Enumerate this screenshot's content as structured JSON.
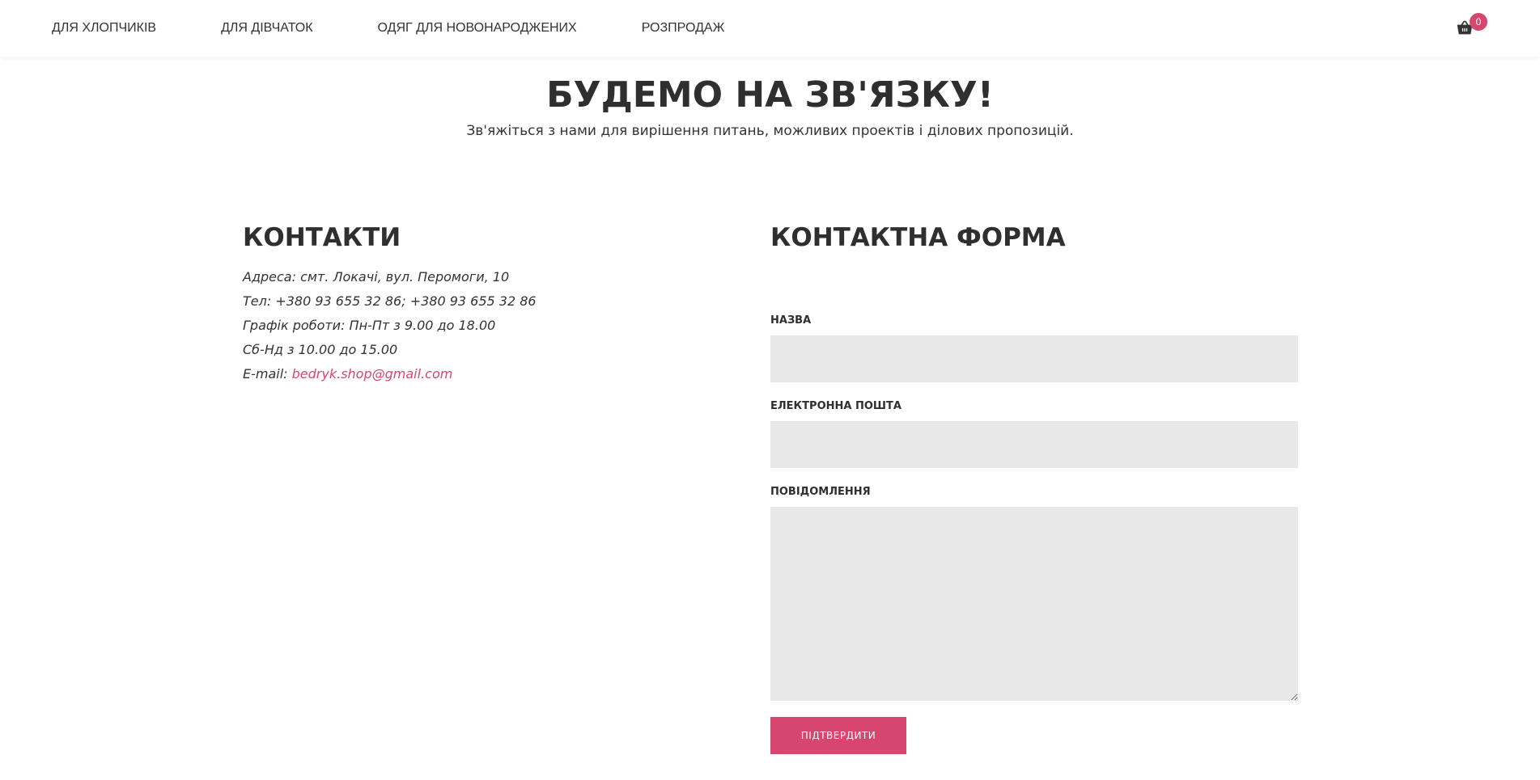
{
  "nav": {
    "items": [
      {
        "label": "ДЛЯ ХЛОПЧИКІВ"
      },
      {
        "label": "ДЛЯ ДІВЧАТОК"
      },
      {
        "label": "ОДЯГ ДЛЯ НОВОНАРОДЖЕНИХ"
      },
      {
        "label": "РОЗПРОДАЖ"
      }
    ],
    "cart": {
      "icon": "basket-icon",
      "count": "0"
    }
  },
  "hero": {
    "title": "БУДЕМО НА ЗВ'ЯЗКУ!",
    "subtitle": "Зв'яжіться з нами для вирішення питань, можливих проектів і ділових пропозицій."
  },
  "contacts": {
    "heading": "КОНТАКТИ",
    "address": "Адреса: смт. Локачі, вул. Перомоги, 10",
    "phone": "Тел: +380 93 655 32 86; +380 93 655 32 86",
    "hours_weekdays": "Графік роботи: Пн-Пт з 9.00 до 18.00",
    "hours_weekend": "Сб-Нд з 10.00 до 15.00",
    "email_label": "E-mail: ",
    "email": "bedryk.shop@gmail.com"
  },
  "form": {
    "heading": "КОНТАКТНА ФОРМА",
    "name_label": "НАЗВА",
    "name_value": "",
    "email_label": "ЕЛЕКТРОННА ПОШТА",
    "email_value": "",
    "message_label": "ПОВІДОМЛЕННЯ",
    "message_value": "",
    "submit_label": "ПІДТВЕРДИТИ"
  },
  "colors": {
    "accent": "#d6466f",
    "field_bg": "#e8e8e8",
    "text": "#333333"
  }
}
